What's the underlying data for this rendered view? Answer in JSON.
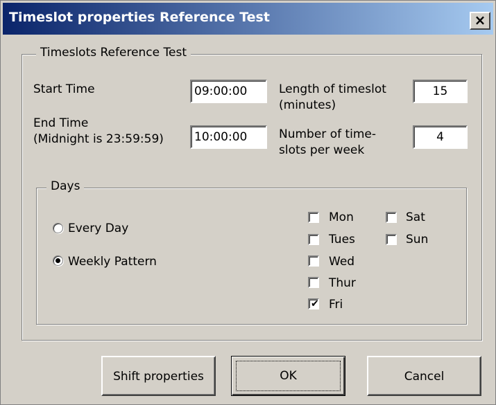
{
  "window": {
    "title": "Timeslot properties Reference Test",
    "close_label": "×"
  },
  "group": {
    "legend": "Timeslots Reference Test"
  },
  "fields": {
    "start_time": {
      "label": "Start Time",
      "value": "09:00:00"
    },
    "end_time": {
      "label_line1": "End Time",
      "label_line2": "(Midnight is 23:59:59)",
      "value": "10:00:00"
    },
    "length": {
      "label_line1": "Length of timeslot",
      "label_line2": "(minutes)",
      "value": "15"
    },
    "number": {
      "label_line1": "Number of time-",
      "label_line2": "slots per week",
      "value": "4"
    }
  },
  "days": {
    "legend": "Days",
    "radios": [
      {
        "label": "Every Day",
        "selected": false
      },
      {
        "label": "Weekly Pattern",
        "selected": true
      }
    ],
    "checkboxes": [
      {
        "label": "Mon",
        "checked": false
      },
      {
        "label": "Tues",
        "checked": false
      },
      {
        "label": "Wed",
        "checked": false
      },
      {
        "label": "Thur",
        "checked": false
      },
      {
        "label": "Fri",
        "checked": true
      },
      {
        "label": "Sat",
        "checked": false
      },
      {
        "label": "Sun",
        "checked": false
      }
    ]
  },
  "buttons": {
    "shift_properties": "Shift properties",
    "ok": "OK",
    "cancel": "Cancel"
  },
  "icons": {
    "radio": "radio-icon",
    "checkbox": "checkbox-icon",
    "check_mark": "✔"
  }
}
